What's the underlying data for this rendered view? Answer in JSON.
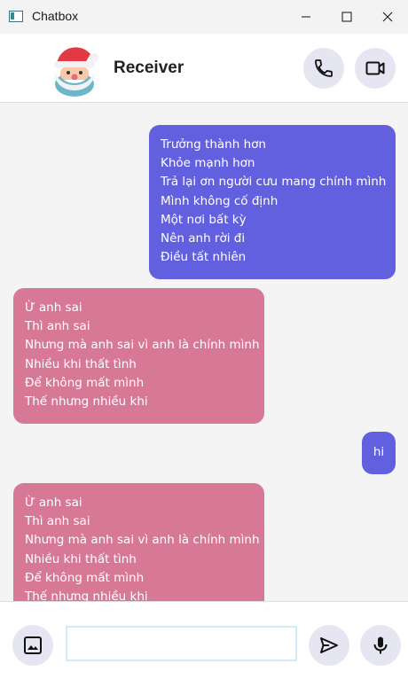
{
  "window": {
    "title": "Chatbox"
  },
  "header": {
    "receiver_name": "Receiver",
    "avatar_icon": "santa-claus-icon",
    "call_icon": "phone-icon",
    "video_icon": "video-camera-icon"
  },
  "colors": {
    "sent_bubble": "#6260df",
    "received_bubble": "#d67896",
    "chat_background": "#f4f4f4",
    "icon_button_bg": "#e6e6f3"
  },
  "messages": [
    {
      "direction": "sent",
      "lines": [
        "Trưởng thành hơn",
        "Khỏe mạnh hơn",
        "Trả lại ơn người cưu mang chính mình",
        "Mình không cố định",
        "Một nơi bất kỳ",
        "Nên anh rời đi",
        "Điều tất nhiên"
      ]
    },
    {
      "direction": "received",
      "lines": [
        "Ừ anh sai",
        "Thì anh sai",
        "Nhưng mà anh sai vì anh là chính mình",
        "Nhiều khi thất tình",
        "Để không mất mình",
        "Thế nhưng nhiều khi"
      ]
    },
    {
      "direction": "sent",
      "lines": [
        "hi"
      ]
    },
    {
      "direction": "received",
      "lines": [
        "Ừ anh sai",
        "Thì anh sai",
        "Nhưng mà anh sai vì anh là chính mình",
        "Nhiều khi thất tình",
        "Để không mất mình",
        "Thế nhưng nhiều khi"
      ]
    }
  ],
  "composer": {
    "value": "",
    "image_icon": "image-icon",
    "send_icon": "send-icon",
    "mic_icon": "microphone-icon"
  }
}
